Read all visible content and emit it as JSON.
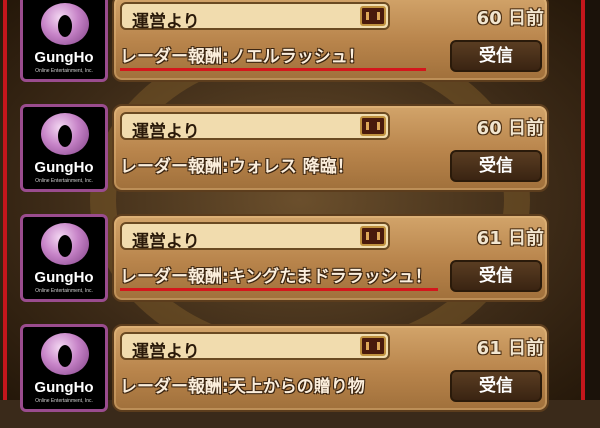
{
  "logo": {
    "name": "GungHo",
    "sub": "Online Entertainment, Inc."
  },
  "colors": {
    "accent_red": "#c4161c",
    "card_brown": "#b8844b",
    "logo_purple": "#9a4c8e"
  },
  "icons": {
    "mail": "treasure-chest-icon"
  },
  "messages": [
    {
      "sender": "運営より",
      "days": "60 日前",
      "text": "レーダー報酬:ノエルラッシュ！",
      "button": "受信",
      "underlined": true
    },
    {
      "sender": "運営より",
      "days": "60 日前",
      "text": "レーダー報酬:ウォレス 降臨！",
      "button": "受信",
      "underlined": false
    },
    {
      "sender": "運営より",
      "days": "61 日前",
      "text": "レーダー報酬:キングたまドララッシュ！",
      "button": "受信",
      "underlined": true
    },
    {
      "sender": "運営より",
      "days": "61 日前",
      "text": "レーダー報酬:天上からの贈り物",
      "button": "受信",
      "underlined": false
    }
  ]
}
